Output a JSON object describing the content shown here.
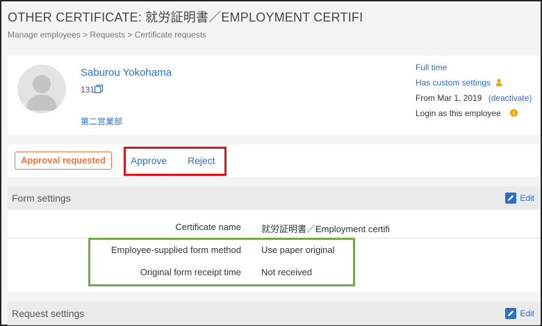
{
  "header": {
    "title": "OTHER CERTIFICATE: 就労証明書／EMPLOYMENT CERTIFI",
    "breadcrumb": "Manage employees > Requests > Certificate requests"
  },
  "employee": {
    "name": "Saburou Yokohama",
    "id": "131",
    "department": "第二営業部",
    "employment_type": "Full time",
    "custom_settings": "Has custom settings",
    "from_date": "From Mar 1, 2019",
    "deactivate": "(deactivate)",
    "login_as": "Login as this employee"
  },
  "actions": {
    "status": "Approval requested",
    "approve": "Approve",
    "reject": "Reject"
  },
  "form_settings": {
    "title": "Form settings",
    "edit": "Edit",
    "rows": [
      {
        "label": "Certificate name",
        "value": "就労証明書／Employment certifi"
      },
      {
        "label": "Employee-supplied form method",
        "value": "Use paper original"
      },
      {
        "label": "Original form receipt time",
        "value": "Not received"
      }
    ]
  },
  "request_settings": {
    "title": "Request settings",
    "edit": "Edit"
  },
  "colors": {
    "link": "#2a6fc9",
    "status": "#e8743b",
    "highlight_red": "#e0141f",
    "highlight_green": "#74a84a",
    "warning_icon": "#f0a30a"
  },
  "icons": [
    "copy-icon",
    "person-icon",
    "info-icon",
    "edit-icon",
    "avatar-placeholder"
  ]
}
